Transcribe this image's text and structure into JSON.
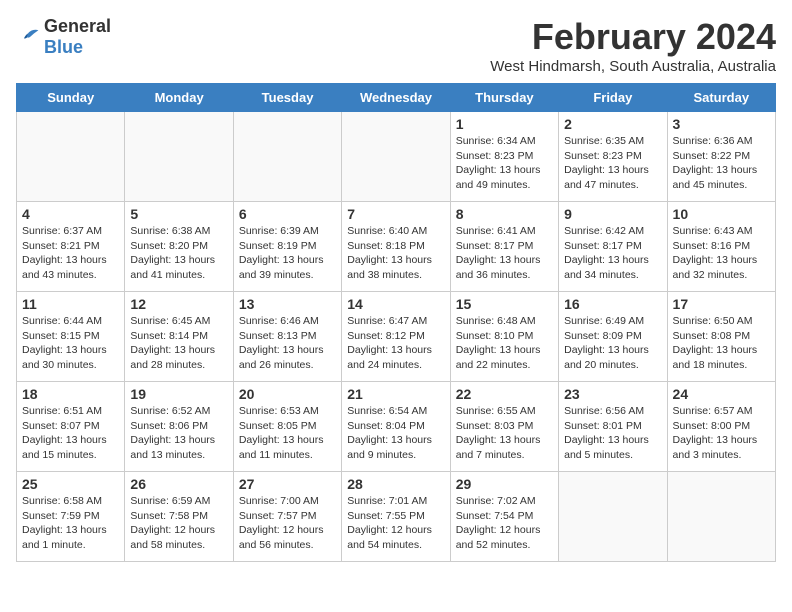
{
  "header": {
    "logo_general": "General",
    "logo_blue": "Blue",
    "title": "February 2024",
    "subtitle": "West Hindmarsh, South Australia, Australia"
  },
  "weekdays": [
    "Sunday",
    "Monday",
    "Tuesday",
    "Wednesday",
    "Thursday",
    "Friday",
    "Saturday"
  ],
  "weeks": [
    [
      {
        "day": "",
        "info": ""
      },
      {
        "day": "",
        "info": ""
      },
      {
        "day": "",
        "info": ""
      },
      {
        "day": "",
        "info": ""
      },
      {
        "day": "1",
        "info": "Sunrise: 6:34 AM\nSunset: 8:23 PM\nDaylight: 13 hours\nand 49 minutes."
      },
      {
        "day": "2",
        "info": "Sunrise: 6:35 AM\nSunset: 8:23 PM\nDaylight: 13 hours\nand 47 minutes."
      },
      {
        "day": "3",
        "info": "Sunrise: 6:36 AM\nSunset: 8:22 PM\nDaylight: 13 hours\nand 45 minutes."
      }
    ],
    [
      {
        "day": "4",
        "info": "Sunrise: 6:37 AM\nSunset: 8:21 PM\nDaylight: 13 hours\nand 43 minutes."
      },
      {
        "day": "5",
        "info": "Sunrise: 6:38 AM\nSunset: 8:20 PM\nDaylight: 13 hours\nand 41 minutes."
      },
      {
        "day": "6",
        "info": "Sunrise: 6:39 AM\nSunset: 8:19 PM\nDaylight: 13 hours\nand 39 minutes."
      },
      {
        "day": "7",
        "info": "Sunrise: 6:40 AM\nSunset: 8:18 PM\nDaylight: 13 hours\nand 38 minutes."
      },
      {
        "day": "8",
        "info": "Sunrise: 6:41 AM\nSunset: 8:17 PM\nDaylight: 13 hours\nand 36 minutes."
      },
      {
        "day": "9",
        "info": "Sunrise: 6:42 AM\nSunset: 8:17 PM\nDaylight: 13 hours\nand 34 minutes."
      },
      {
        "day": "10",
        "info": "Sunrise: 6:43 AM\nSunset: 8:16 PM\nDaylight: 13 hours\nand 32 minutes."
      }
    ],
    [
      {
        "day": "11",
        "info": "Sunrise: 6:44 AM\nSunset: 8:15 PM\nDaylight: 13 hours\nand 30 minutes."
      },
      {
        "day": "12",
        "info": "Sunrise: 6:45 AM\nSunset: 8:14 PM\nDaylight: 13 hours\nand 28 minutes."
      },
      {
        "day": "13",
        "info": "Sunrise: 6:46 AM\nSunset: 8:13 PM\nDaylight: 13 hours\nand 26 minutes."
      },
      {
        "day": "14",
        "info": "Sunrise: 6:47 AM\nSunset: 8:12 PM\nDaylight: 13 hours\nand 24 minutes."
      },
      {
        "day": "15",
        "info": "Sunrise: 6:48 AM\nSunset: 8:10 PM\nDaylight: 13 hours\nand 22 minutes."
      },
      {
        "day": "16",
        "info": "Sunrise: 6:49 AM\nSunset: 8:09 PM\nDaylight: 13 hours\nand 20 minutes."
      },
      {
        "day": "17",
        "info": "Sunrise: 6:50 AM\nSunset: 8:08 PM\nDaylight: 13 hours\nand 18 minutes."
      }
    ],
    [
      {
        "day": "18",
        "info": "Sunrise: 6:51 AM\nSunset: 8:07 PM\nDaylight: 13 hours\nand 15 minutes."
      },
      {
        "day": "19",
        "info": "Sunrise: 6:52 AM\nSunset: 8:06 PM\nDaylight: 13 hours\nand 13 minutes."
      },
      {
        "day": "20",
        "info": "Sunrise: 6:53 AM\nSunset: 8:05 PM\nDaylight: 13 hours\nand 11 minutes."
      },
      {
        "day": "21",
        "info": "Sunrise: 6:54 AM\nSunset: 8:04 PM\nDaylight: 13 hours\nand 9 minutes."
      },
      {
        "day": "22",
        "info": "Sunrise: 6:55 AM\nSunset: 8:03 PM\nDaylight: 13 hours\nand 7 minutes."
      },
      {
        "day": "23",
        "info": "Sunrise: 6:56 AM\nSunset: 8:01 PM\nDaylight: 13 hours\nand 5 minutes."
      },
      {
        "day": "24",
        "info": "Sunrise: 6:57 AM\nSunset: 8:00 PM\nDaylight: 13 hours\nand 3 minutes."
      }
    ],
    [
      {
        "day": "25",
        "info": "Sunrise: 6:58 AM\nSunset: 7:59 PM\nDaylight: 13 hours\nand 1 minute."
      },
      {
        "day": "26",
        "info": "Sunrise: 6:59 AM\nSunset: 7:58 PM\nDaylight: 12 hours\nand 58 minutes."
      },
      {
        "day": "27",
        "info": "Sunrise: 7:00 AM\nSunset: 7:57 PM\nDaylight: 12 hours\nand 56 minutes."
      },
      {
        "day": "28",
        "info": "Sunrise: 7:01 AM\nSunset: 7:55 PM\nDaylight: 12 hours\nand 54 minutes."
      },
      {
        "day": "29",
        "info": "Sunrise: 7:02 AM\nSunset: 7:54 PM\nDaylight: 12 hours\nand 52 minutes."
      },
      {
        "day": "",
        "info": ""
      },
      {
        "day": "",
        "info": ""
      }
    ]
  ]
}
